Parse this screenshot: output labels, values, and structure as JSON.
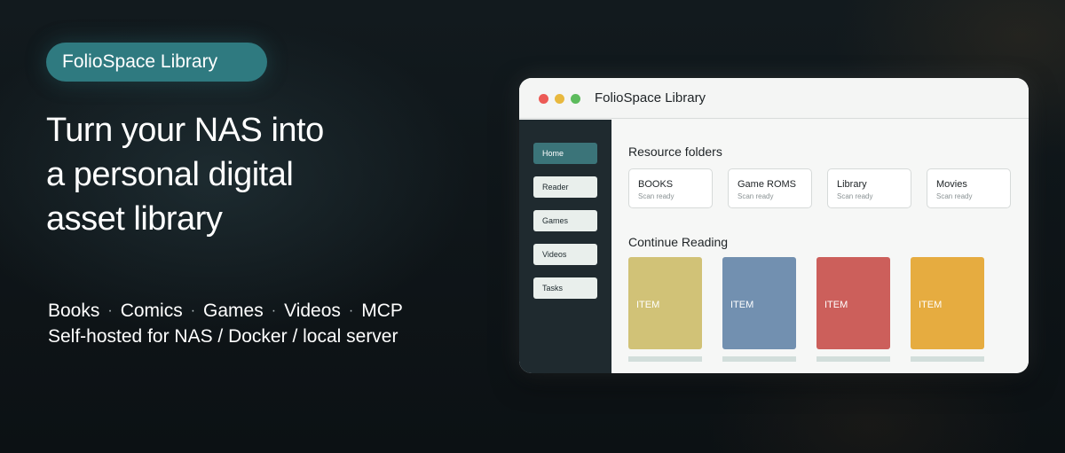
{
  "badge": {
    "label": "FolioSpace Library"
  },
  "headline": {
    "lines": [
      "Turn your NAS into",
      "a personal digital",
      "asset library"
    ]
  },
  "features": {
    "categories": [
      "Books",
      "Comics",
      "Games",
      "Videos",
      "MCP"
    ],
    "separator": "·",
    "hosting": "Self-hosted for NAS / Docker / local server"
  },
  "window": {
    "title": "FolioSpace Library",
    "sidebar": {
      "items": [
        {
          "label": "Home",
          "active": true
        },
        {
          "label": "Reader",
          "active": false
        },
        {
          "label": "Games",
          "active": false
        },
        {
          "label": "Videos",
          "active": false
        },
        {
          "label": "Tasks",
          "active": false
        }
      ]
    },
    "resource_folders": {
      "title": "Resource folders",
      "folders": [
        {
          "name": "BOOKS",
          "status": "Scan ready"
        },
        {
          "name": "Game ROMS",
          "status": "Scan ready"
        },
        {
          "name": "Library",
          "status": "Scan ready"
        },
        {
          "name": "Movies",
          "status": "Scan ready"
        }
      ]
    },
    "continue_reading": {
      "title": "Continue Reading",
      "items": [
        {
          "label": "ITEM",
          "color": "#d1c277"
        },
        {
          "label": "ITEM",
          "color": "#7290b0"
        },
        {
          "label": "ITEM",
          "color": "#cc5f5b"
        },
        {
          "label": "ITEM",
          "color": "#e6ac40"
        }
      ]
    }
  },
  "colors": {
    "accent": "#2f7a80",
    "sidebar_active": "#3b7479",
    "sidebar_bg": "#1f2a2f"
  }
}
